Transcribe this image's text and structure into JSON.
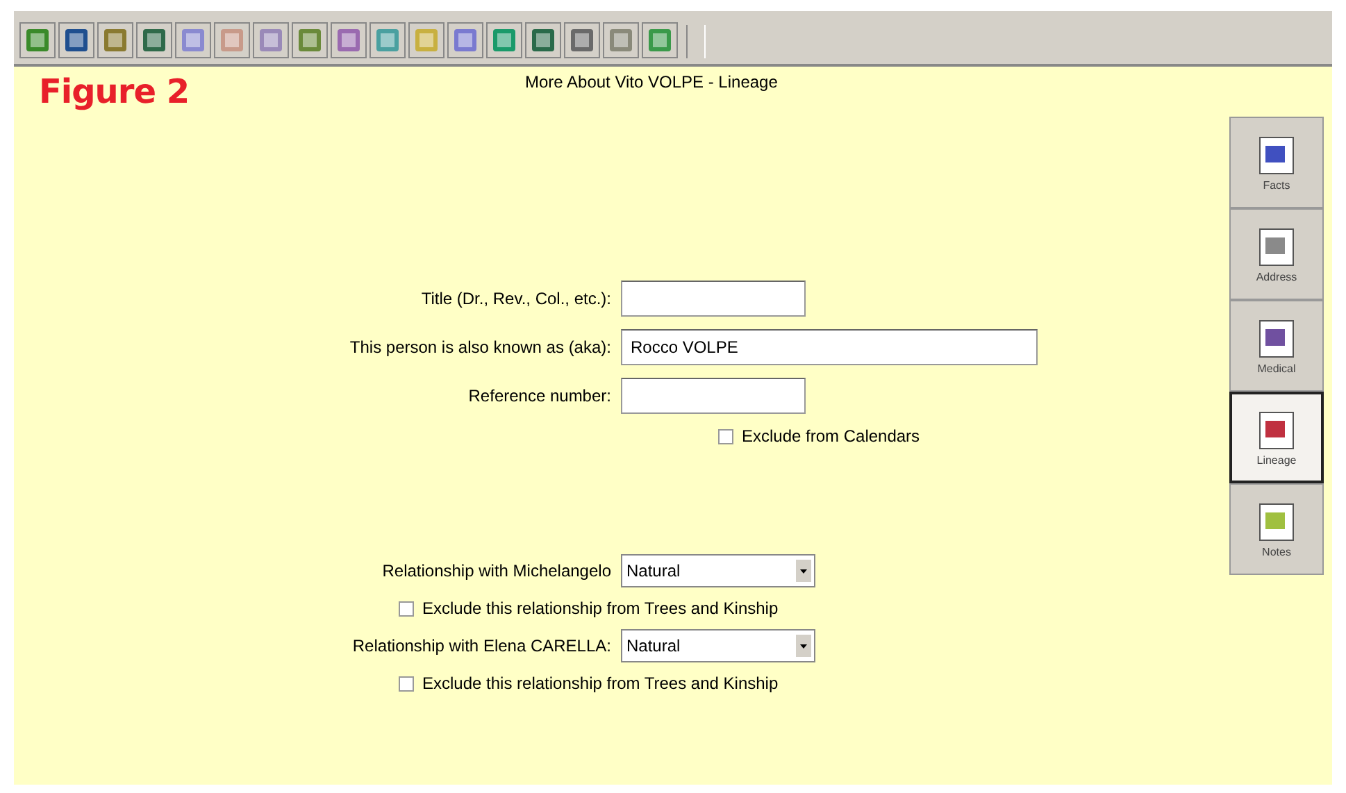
{
  "figure_label": "Figure 2",
  "title": "More About Vito VOLPE - Lineage",
  "fields": [
    {
      "label": "Title (Dr., Rev., Col., etc.):",
      "kind": "short"
    },
    {
      "label": "This person is also known as (aka):",
      "value": "Rocco VOLPE",
      "kind": "long"
    },
    {
      "label": "Reference number:",
      "kind": "short"
    }
  ],
  "exclude_calendars": {
    "label": "Exclude from Calendars",
    "checked": false
  },
  "relationships": [
    {
      "label": "Relationship with Michelangelo",
      "value": "Natural",
      "exclude": {
        "label": "Exclude this relationship from Trees and Kinship",
        "checked": false
      }
    },
    {
      "label": "Relationship with Elena CARELLA:",
      "value": "Natural",
      "exclude": {
        "label": "Exclude this relationship from Trees and Kinship",
        "checked": false
      }
    }
  ],
  "side_tabs": [
    {
      "label": "Facts",
      "selected": false
    },
    {
      "label": "Address",
      "selected": false
    },
    {
      "label": "Medical",
      "selected": false
    },
    {
      "label": "Lineage",
      "selected": true
    },
    {
      "label": "Notes",
      "selected": false
    }
  ]
}
